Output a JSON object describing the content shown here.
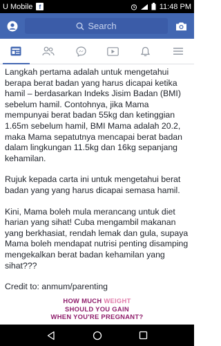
{
  "status_bar": {
    "carrier": "U Mobile",
    "time": "11:48 PM",
    "icons": [
      "facebook-icon",
      "alarm-icon",
      "signal-icon",
      "battery-icon"
    ]
  },
  "top_bar": {
    "search_placeholder": "Search",
    "left_icon": "profile-icon",
    "right_icon": "camera-icon",
    "brand_color": "#4267b2"
  },
  "nav_tabs": [
    {
      "icon": "news-feed-icon",
      "active": true
    },
    {
      "icon": "friends-icon",
      "active": false
    },
    {
      "icon": "messenger-icon",
      "active": false
    },
    {
      "icon": "video-icon",
      "active": false
    },
    {
      "icon": "notifications-icon",
      "active": false
    },
    {
      "icon": "menu-icon",
      "active": false
    }
  ],
  "post": {
    "paragraphs": [
      "Langkah pertama adalah untuk mengetahui berapa berat badan yang harus dicapai ketika hamil – berdasarkan Indeks Jisim Badan (BMI) sebelum hamil. Contohnya, jika Mama mempunyai berat badan 55kg dan ketinggian 1.65m sebelum hamil, BMI Mama adalah 20.2, maka Mama sepatutnya mencapai berat badan dalam lingkungan 11.5kg dan 16kg sepanjang kehamilan.",
      "Rujuk kepada carta ini untuk mengetahui berat badan yang yang harus dicapai semasa hamil.",
      "Kini, Mama boleh mula merancang untuk diet harian yang sihat! Cuba mengambil makanan yang berkhasiat, rendah lemak dan gula, supaya Mama boleh mendapat nutrisi penting disamping mengekalkan berat badan kehamilan yang sihat???",
      "Credit to: anmum/parenting"
    ]
  },
  "banner": {
    "line1_a": "HOW MUCH ",
    "line1_b": "WEIGHT",
    "line2": "SHOULD YOU GAIN",
    "line3": "WHEN YOU'RE PREGNANT?",
    "colors": {
      "primary": "#8e1b6a",
      "accent": "#e07aa8"
    }
  },
  "system_nav": {
    "icons": [
      "back-icon",
      "home-icon",
      "recents-icon"
    ]
  }
}
